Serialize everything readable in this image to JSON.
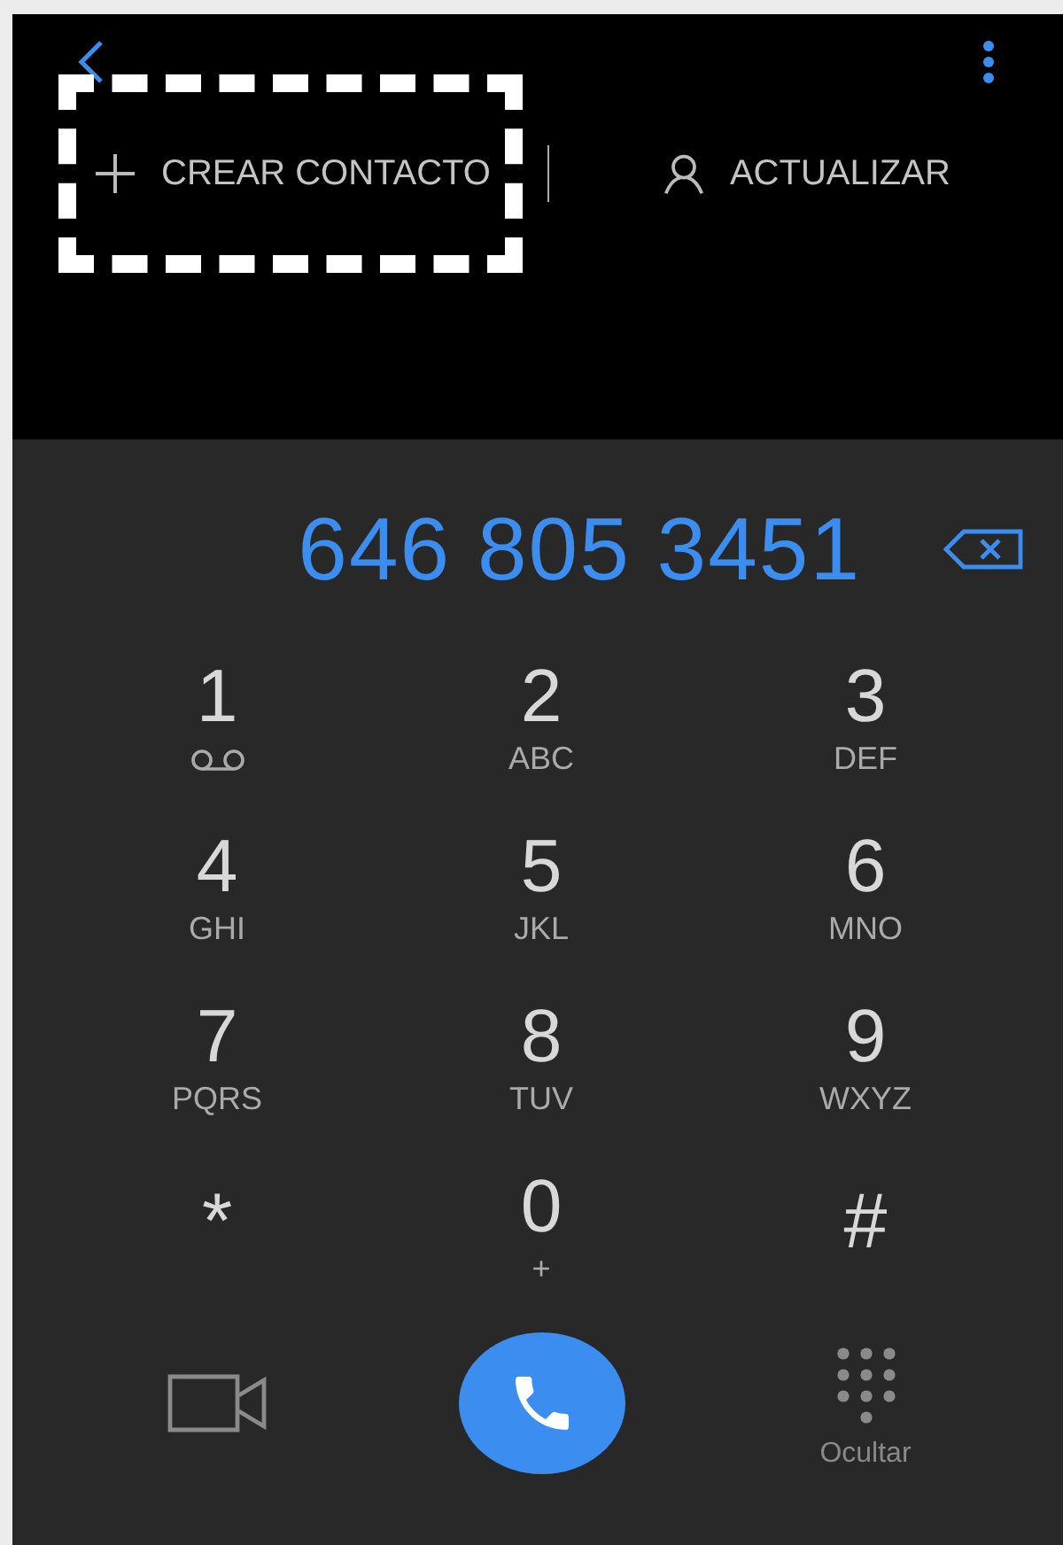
{
  "top_bar": {
    "actions": [
      {
        "label": "CREAR CONTACTO",
        "kind": "add",
        "highlighted": true
      },
      {
        "label": "ACTUALIZAR",
        "kind": "contact"
      }
    ]
  },
  "display": {
    "number": "646 805 3451"
  },
  "keys": [
    {
      "digit": "1",
      "kind": "voicemail"
    },
    {
      "digit": "2",
      "kind": "letters",
      "letters": "ABC"
    },
    {
      "digit": "3",
      "kind": "letters",
      "letters": "DEF"
    },
    {
      "digit": "4",
      "kind": "letters",
      "letters": "GHI"
    },
    {
      "digit": "5",
      "kind": "letters",
      "letters": "JKL"
    },
    {
      "digit": "6",
      "kind": "letters",
      "letters": "MNO"
    },
    {
      "digit": "7",
      "kind": "letters",
      "letters": "PQRS"
    },
    {
      "digit": "8",
      "kind": "letters",
      "letters": "TUV"
    },
    {
      "digit": "9",
      "kind": "letters",
      "letters": "WXYZ"
    },
    {
      "digit": "*",
      "kind": "plain"
    },
    {
      "digit": "0",
      "kind": "letters",
      "letters": "+"
    },
    {
      "digit": "#",
      "kind": "plain"
    }
  ],
  "bottom_bar": {
    "hide_label": "Ocultar"
  }
}
